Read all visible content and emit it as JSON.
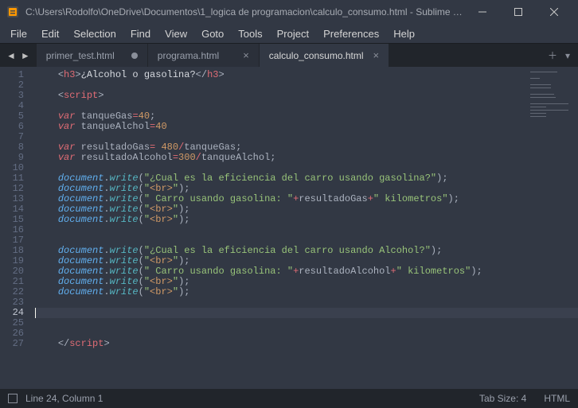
{
  "window": {
    "title": "C:\\Users\\Rodolfo\\OneDrive\\Documentos\\1_logica de programacion\\calculo_consumo.html - Sublime Te..."
  },
  "menu": [
    "File",
    "Edit",
    "Selection",
    "Find",
    "View",
    "Goto",
    "Tools",
    "Project",
    "Preferences",
    "Help"
  ],
  "tabs": [
    {
      "label": "primer_test.html",
      "dirty": true,
      "active": false
    },
    {
      "label": "programa.html",
      "dirty": false,
      "active": false
    },
    {
      "label": "calculo_consumo.html",
      "dirty": false,
      "active": true
    }
  ],
  "code": {
    "active_line": 24,
    "lines": [
      [
        [
          "    "
        ],
        [
          "<",
          "c-punc"
        ],
        [
          "h3",
          "c-tag"
        ],
        [
          ">",
          "c-punc"
        ],
        [
          "¿Alcohol o gasolina?"
        ],
        [
          "</",
          "c-punc"
        ],
        [
          "h3",
          "c-tag"
        ],
        [
          ">",
          "c-punc"
        ]
      ],
      [],
      [
        [
          "    "
        ],
        [
          "<",
          "c-punc"
        ],
        [
          "script",
          "c-tag"
        ],
        [
          ">",
          "c-punc"
        ]
      ],
      [],
      [
        [
          "    "
        ],
        [
          "var",
          "c-key"
        ],
        [
          " "
        ],
        [
          "tanqueGas",
          "c-var"
        ],
        [
          "=",
          "c-op"
        ],
        [
          "40",
          "c-num"
        ],
        [
          ";",
          "c-punc"
        ]
      ],
      [
        [
          "    "
        ],
        [
          "var",
          "c-key"
        ],
        [
          " "
        ],
        [
          "tanqueAlchol",
          "c-var"
        ],
        [
          "=",
          "c-op"
        ],
        [
          "40",
          "c-num"
        ]
      ],
      [],
      [
        [
          "    "
        ],
        [
          "var",
          "c-key"
        ],
        [
          " "
        ],
        [
          "resultadoGas",
          "c-var"
        ],
        [
          "=",
          "c-op"
        ],
        [
          " "
        ],
        [
          "480",
          "c-num"
        ],
        [
          "/",
          "c-op"
        ],
        [
          "tanqueGas",
          "c-var"
        ],
        [
          ";",
          "c-punc"
        ]
      ],
      [
        [
          "    "
        ],
        [
          "var",
          "c-key"
        ],
        [
          " "
        ],
        [
          "resultadoAlcohol",
          "c-var"
        ],
        [
          "=",
          "c-op"
        ],
        [
          "300",
          "c-num"
        ],
        [
          "/",
          "c-op"
        ],
        [
          "tanqueAlchol",
          "c-var"
        ],
        [
          ";",
          "c-punc"
        ]
      ],
      [],
      [
        [
          "    "
        ],
        [
          "document",
          "c-ital"
        ],
        [
          ".",
          "c-punc"
        ],
        [
          "write",
          "c-func"
        ],
        [
          "(",
          "c-punc"
        ],
        [
          "\"¿Cual es la eficiencia del carro usando gasolina?\"",
          "c-str"
        ],
        [
          ")",
          "c-punc"
        ],
        [
          ";",
          "c-punc"
        ]
      ],
      [
        [
          "    "
        ],
        [
          "document",
          "c-ital"
        ],
        [
          ".",
          "c-punc"
        ],
        [
          "write",
          "c-func"
        ],
        [
          "(",
          "c-punc"
        ],
        [
          "\"",
          "c-str"
        ],
        [
          "<br>",
          "c-lbrk"
        ],
        [
          "\"",
          "c-str"
        ],
        [
          ")",
          "c-punc"
        ],
        [
          ";",
          "c-punc"
        ]
      ],
      [
        [
          "    "
        ],
        [
          "document",
          "c-ital"
        ],
        [
          ".",
          "c-punc"
        ],
        [
          "write",
          "c-func"
        ],
        [
          "(",
          "c-punc"
        ],
        [
          "\" Carro usando gasolina: \"",
          "c-str"
        ],
        [
          "+",
          "c-op"
        ],
        [
          "resultadoGas",
          "c-var"
        ],
        [
          "+",
          "c-op"
        ],
        [
          "\" kilometros\"",
          "c-str"
        ],
        [
          ")",
          "c-punc"
        ],
        [
          ";",
          "c-punc"
        ]
      ],
      [
        [
          "    "
        ],
        [
          "document",
          "c-ital"
        ],
        [
          ".",
          "c-punc"
        ],
        [
          "write",
          "c-func"
        ],
        [
          "(",
          "c-punc"
        ],
        [
          "\"",
          "c-str"
        ],
        [
          "<br>",
          "c-lbrk"
        ],
        [
          "\"",
          "c-str"
        ],
        [
          ")",
          "c-punc"
        ],
        [
          ";",
          "c-punc"
        ]
      ],
      [
        [
          "    "
        ],
        [
          "document",
          "c-ital"
        ],
        [
          ".",
          "c-punc"
        ],
        [
          "write",
          "c-func"
        ],
        [
          "(",
          "c-punc"
        ],
        [
          "\"",
          "c-str"
        ],
        [
          "<br>",
          "c-lbrk"
        ],
        [
          "\"",
          "c-str"
        ],
        [
          ")",
          "c-punc"
        ],
        [
          ";",
          "c-punc"
        ]
      ],
      [],
      [],
      [
        [
          "    "
        ],
        [
          "document",
          "c-ital"
        ],
        [
          ".",
          "c-punc"
        ],
        [
          "write",
          "c-func"
        ],
        [
          "(",
          "c-punc"
        ],
        [
          "\"¿Cual es la eficiencia del carro usando Alcohol?\"",
          "c-str"
        ],
        [
          ")",
          "c-punc"
        ],
        [
          ";",
          "c-punc"
        ]
      ],
      [
        [
          "    "
        ],
        [
          "document",
          "c-ital"
        ],
        [
          ".",
          "c-punc"
        ],
        [
          "write",
          "c-func"
        ],
        [
          "(",
          "c-punc"
        ],
        [
          "\"",
          "c-str"
        ],
        [
          "<br>",
          "c-lbrk"
        ],
        [
          "\"",
          "c-str"
        ],
        [
          ")",
          "c-punc"
        ],
        [
          ";",
          "c-punc"
        ]
      ],
      [
        [
          "    "
        ],
        [
          "document",
          "c-ital"
        ],
        [
          ".",
          "c-punc"
        ],
        [
          "write",
          "c-func"
        ],
        [
          "(",
          "c-punc"
        ],
        [
          "\" Carro usando gasolina: \"",
          "c-str"
        ],
        [
          "+",
          "c-op"
        ],
        [
          "resultadoAlcohol",
          "c-var"
        ],
        [
          "+",
          "c-op"
        ],
        [
          "\" kilometros\"",
          "c-str"
        ],
        [
          ")",
          "c-punc"
        ],
        [
          ";",
          "c-punc"
        ]
      ],
      [
        [
          "    "
        ],
        [
          "document",
          "c-ital"
        ],
        [
          ".",
          "c-punc"
        ],
        [
          "write",
          "c-func"
        ],
        [
          "(",
          "c-punc"
        ],
        [
          "\"",
          "c-str"
        ],
        [
          "<br>",
          "c-lbrk"
        ],
        [
          "\"",
          "c-str"
        ],
        [
          ")",
          "c-punc"
        ],
        [
          ";",
          "c-punc"
        ]
      ],
      [
        [
          "    "
        ],
        [
          "document",
          "c-ital"
        ],
        [
          ".",
          "c-punc"
        ],
        [
          "write",
          "c-func"
        ],
        [
          "(",
          "c-punc"
        ],
        [
          "\"",
          "c-str"
        ],
        [
          "<br>",
          "c-lbrk"
        ],
        [
          "\"",
          "c-str"
        ],
        [
          ")",
          "c-punc"
        ],
        [
          ";",
          "c-punc"
        ]
      ],
      [],
      [],
      [],
      [],
      [
        [
          "    "
        ],
        [
          "</",
          "c-punc"
        ],
        [
          "script",
          "c-tag"
        ],
        [
          ">",
          "c-punc"
        ]
      ]
    ]
  },
  "status": {
    "cursor": "Line 24, Column 1",
    "tabsize": "Tab Size: 4",
    "syntax": "HTML"
  }
}
